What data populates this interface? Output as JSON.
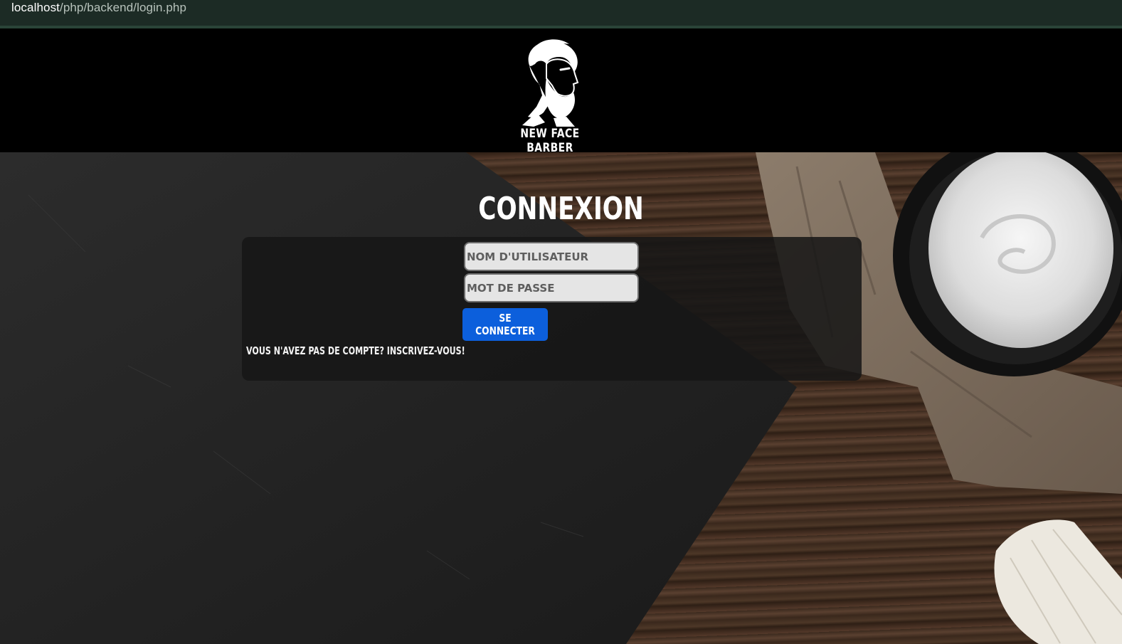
{
  "browser": {
    "url_host": "localhost",
    "url_path": "/php/backend/login.php"
  },
  "header": {
    "brand_name": "NEW FACE BARBER",
    "logo_icon": "barber-bearded-man-icon"
  },
  "login": {
    "title": "CONNEXION",
    "username_placeholder": "NOM D'UTILISATEUR",
    "password_placeholder": "MOT DE PASSE",
    "submit_label": "SE CONNECTER",
    "signup_link": "VOUS N'AVEZ PAS DE COMPTE? INSCRIVEZ-VOUS!"
  },
  "colors": {
    "accent": "#0c5fdc",
    "header_bg": "#000000",
    "urlbar_bg": "#1c2b25"
  }
}
